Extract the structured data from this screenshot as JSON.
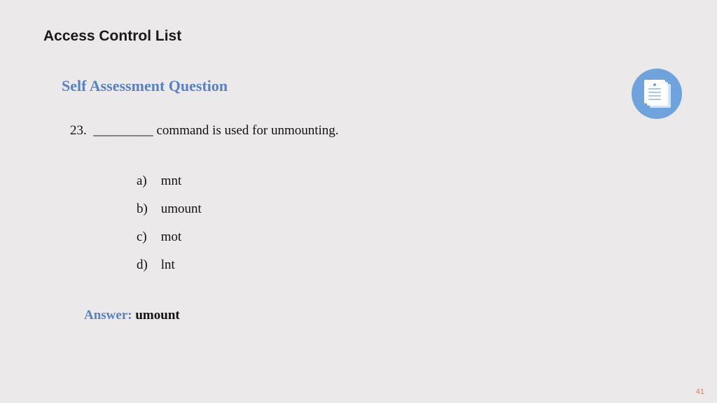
{
  "title": "Access Control List",
  "subheading": "Self Assessment Question",
  "question": {
    "number": "23.",
    "text": "_________ command is used for unmounting."
  },
  "options": [
    {
      "letter": "a)",
      "text": "mnt"
    },
    {
      "letter": "b)",
      "text": "umount"
    },
    {
      "letter": "c)",
      "text": "mot"
    },
    {
      "letter": "d)",
      "text": "lnt"
    }
  ],
  "answer": {
    "label": "Answer:",
    "value": "umount"
  },
  "page_number": "41"
}
